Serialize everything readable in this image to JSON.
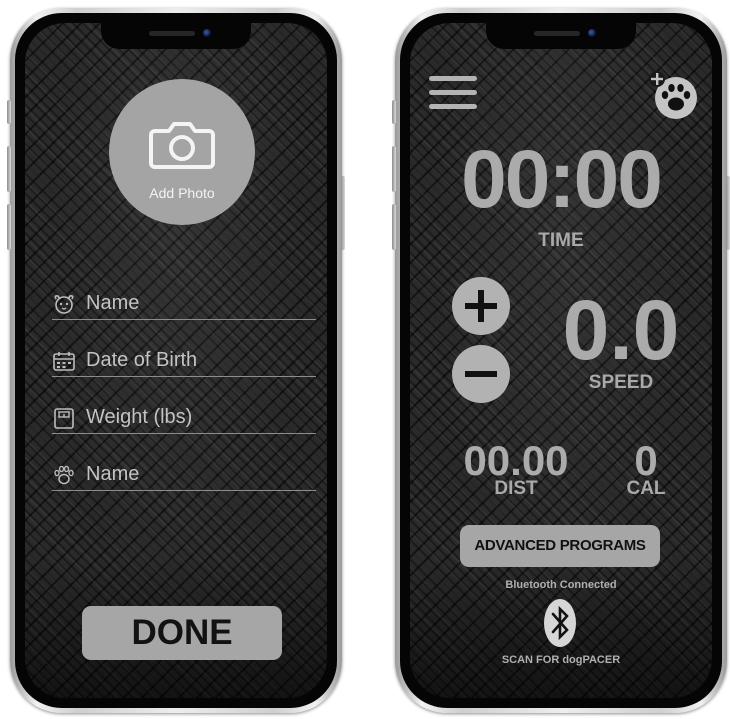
{
  "profile_screen": {
    "add_photo": {
      "icon": "camera-icon",
      "label": "Add Photo"
    },
    "fields": [
      {
        "icon": "dog-face-icon",
        "label": "Name"
      },
      {
        "icon": "calendar-icon",
        "label": "Date of Birth"
      },
      {
        "icon": "scale-icon",
        "label": "Weight (lbs)"
      },
      {
        "icon": "paw-print-icon",
        "label": "Name"
      }
    ],
    "done_label": "DONE"
  },
  "treadmill_screen": {
    "menu_icon": "hamburger-menu-icon",
    "add_dog_icon": "add-dog-paw-icon",
    "time_value": "00:00",
    "time_label": "TIME",
    "increase_icon": "plus-icon",
    "decrease_icon": "minus-icon",
    "speed_value": "0.0",
    "speed_label": "SPEED",
    "distance_value": "00.00",
    "distance_label": "DIST",
    "calories_value": "0",
    "calories_label": "CAL",
    "advanced_programs_label": "ADVANCED PROGRAMS",
    "bluetooth_status": "Bluetooth Connected",
    "bluetooth_icon": "bluetooth-icon",
    "scan_label": "SCAN FOR dogPACER"
  },
  "colors": {
    "screen_background": "#2a2a2a",
    "button_fill": "#a6a6a6",
    "text_gray": "#ababab",
    "field_text": "#c3c3c3"
  }
}
